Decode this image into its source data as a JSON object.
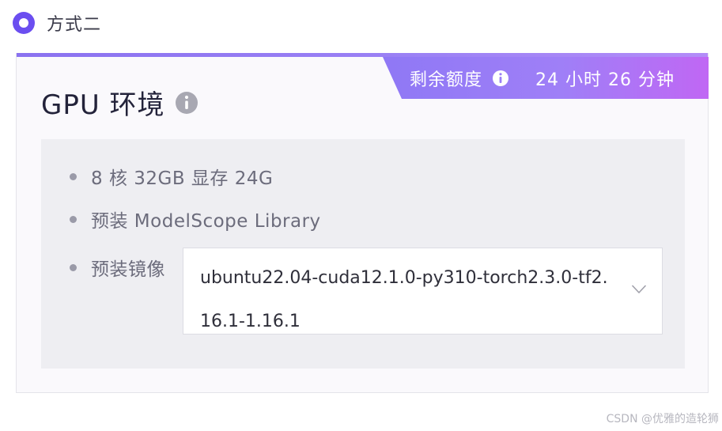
{
  "option": {
    "label": "方式二",
    "selected": true
  },
  "card": {
    "title": "GPU 环境",
    "title_icon": "info-icon",
    "quota": {
      "label": "剩余额度",
      "icon": "info-icon",
      "value": "24 小时 26 分钟"
    },
    "specs": [
      {
        "text": "8 核 32GB 显存 24G"
      },
      {
        "text": "预装 ModelScope Library"
      },
      {
        "text": "预装镜像"
      }
    ],
    "image_select": {
      "value": "ubuntu22.04-cuda12.1.0-py310-torch2.3.0-tf2.16.1-1.16.1",
      "icon": "chevron-down-icon"
    }
  },
  "watermark": "CSDN @优雅的造轮狮",
  "colors": {
    "accent": "#6b4ef0",
    "tab_gradient_start": "#8f78f5",
    "tab_gradient_end": "#c067f4",
    "panel_bg": "#eeeef2"
  }
}
